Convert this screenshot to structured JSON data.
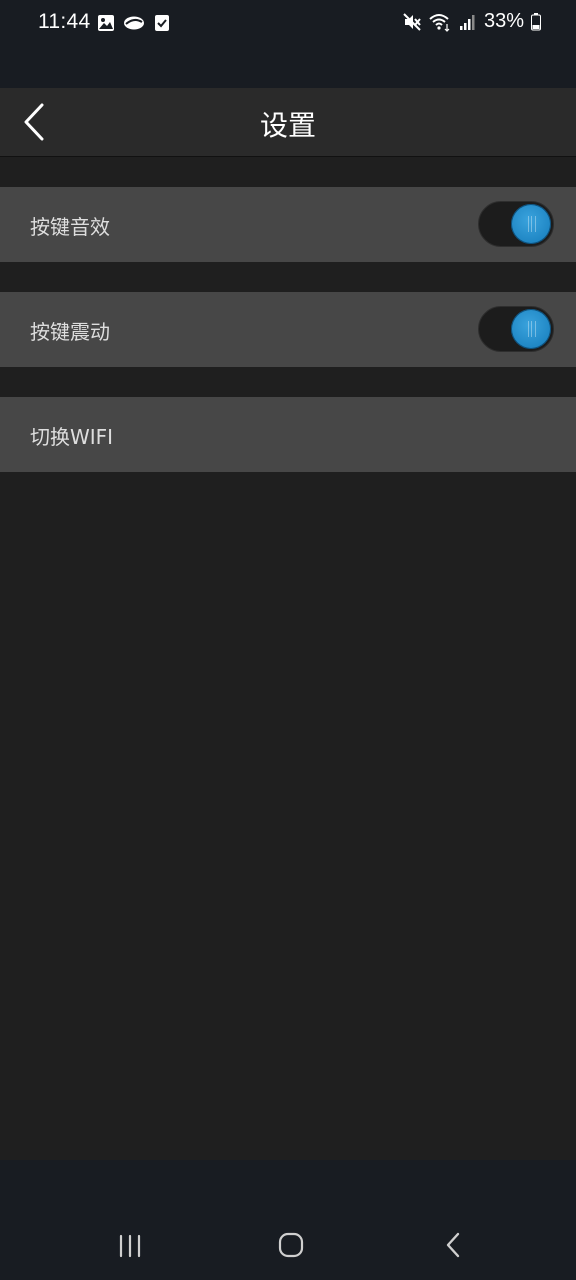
{
  "status_bar": {
    "time": "11:44",
    "battery_percent": "33%",
    "left_icons": [
      "gallery-icon",
      "cloud-icon",
      "checkbox-icon"
    ],
    "right_icons": [
      "mute-icon",
      "wifi-icon",
      "signal-icon",
      "battery-icon"
    ]
  },
  "header": {
    "title": "设置",
    "back_icon": "chevron-left-icon"
  },
  "settings": [
    {
      "label": "按键音效",
      "toggle": true,
      "on": true
    },
    {
      "label": "按键震动",
      "toggle": true,
      "on": true
    },
    {
      "label": "切换WIFI",
      "toggle": false
    }
  ],
  "colors": {
    "accent": "#1f86c4",
    "background": "#1f1f1f",
    "row": "#474747",
    "header": "#2a2a2a",
    "system_bar": "#181c22"
  },
  "nav_bar": {
    "icons": [
      "recent-apps-icon",
      "home-icon",
      "back-icon"
    ]
  }
}
